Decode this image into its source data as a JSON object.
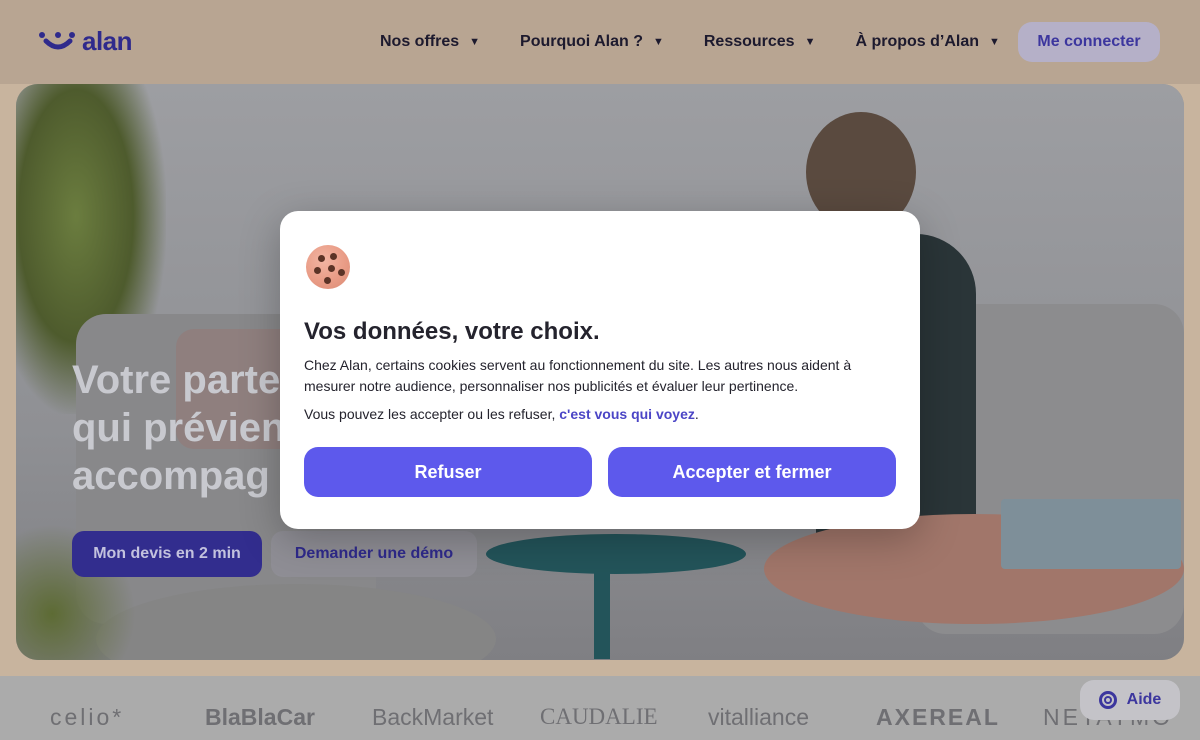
{
  "header": {
    "logo_text": "alan",
    "nav": [
      {
        "label": "Nos offres"
      },
      {
        "label": "Pourquoi Alan ?"
      },
      {
        "label": "Ressources"
      },
      {
        "label": "À propos d’Alan"
      }
    ],
    "caret": "▼",
    "login_label": "Me connecter"
  },
  "hero": {
    "title_lines": [
      "Votre parte",
      "qui prévien",
      "accompag"
    ],
    "primary_cta": "Mon devis en 2 min",
    "secondary_cta": "Demander une démo"
  },
  "brands": [
    "celio*",
    "BlaBlaCar",
    "BackMarket",
    "CAUDALIE",
    "vitalliance",
    "AXEREAL",
    "NETATMO"
  ],
  "help": {
    "label": "Aide"
  },
  "cookie_modal": {
    "title": "Vos données, votre choix.",
    "text1": "Chez Alan, certains cookies servent au fonctionnement du site. Les autres nous aident à mesurer notre audience, personnaliser nos publicités et évaluer leur pertinence.",
    "text2_prefix": "Vous pouvez les accepter ou les refuser, ",
    "text2_link": "c'est vous qui voyez",
    "text2_suffix": ".",
    "refuse_label": "Refuser",
    "accept_label": "Accepter et fermer"
  },
  "colors": {
    "accent": "#5d59ec",
    "brand_dark": "#2f2a8c",
    "link": "#4b45c6"
  },
  "icons": {
    "logo": "alan-logo-icon",
    "cookie": "cookie-icon",
    "help": "lifebuoy-icon",
    "caret": "chevron-down-icon"
  }
}
